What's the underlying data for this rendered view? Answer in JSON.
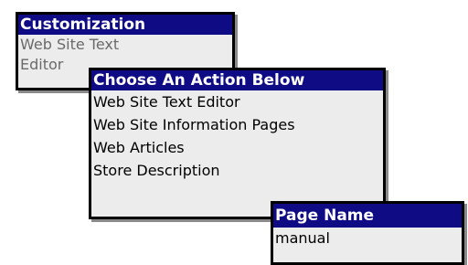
{
  "customization_panel": {
    "header": "Customization",
    "item_line1": "Web Site Text",
    "item_line2": "Editor"
  },
  "action_panel": {
    "header": "Choose An Action Below",
    "items": [
      "Web Site Text Editor",
      "Web Site Information Pages",
      "Web Articles",
      "Store Description"
    ]
  },
  "page_panel": {
    "header": "Page Name",
    "items": [
      "manual"
    ]
  },
  "colors": {
    "header_bg": "#0f0b85",
    "panel_bg": "#ececec"
  }
}
